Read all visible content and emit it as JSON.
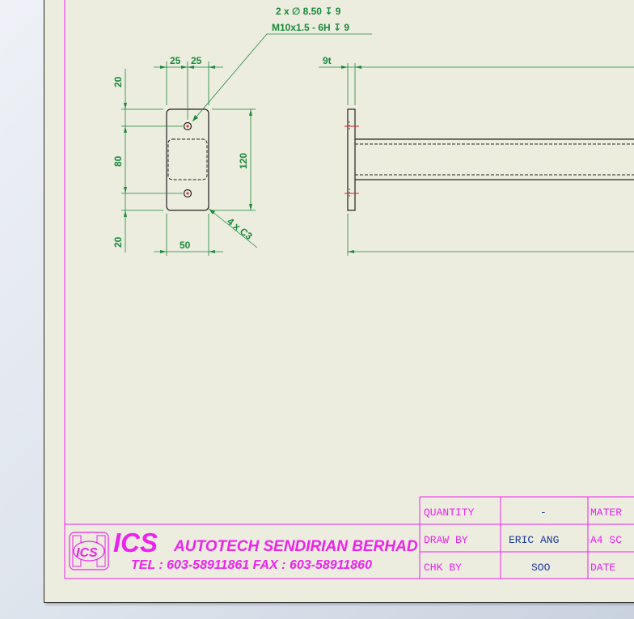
{
  "callout": {
    "hole_spec": "2 x ∅ 8.50 ↧ 9",
    "thread_spec": "M10x1.5 - 6H ↧ 9",
    "chamfer": "4 x C3"
  },
  "dimensions": {
    "top_left": "25",
    "top_right": "25",
    "top_margin": "20",
    "hole_spacing": "80",
    "bottom_margin": "20",
    "height": "120",
    "width": "50",
    "thickness": "9t"
  },
  "title_block": {
    "company_short": "ICS",
    "company_name": "AUTOTECH SENDIRIAN BERHAD",
    "contact": "TEL : 603-58911861  FAX : 603-58911860",
    "logo_text": "ICS",
    "rows": [
      {
        "label": "QUANTITY",
        "value": "-",
        "label2": "MATER"
      },
      {
        "label": "DRAW BY",
        "value": "ERIC ANG",
        "label2": "A4 SC"
      },
      {
        "label": "CHK BY",
        "value": "SOO",
        "label2": "DATE"
      }
    ]
  },
  "colors": {
    "dimension": "#1a8a3a",
    "border": "#ee22ee",
    "part": "#222222",
    "text_value": "#1a3a9a",
    "centerline": "#dd2222"
  }
}
